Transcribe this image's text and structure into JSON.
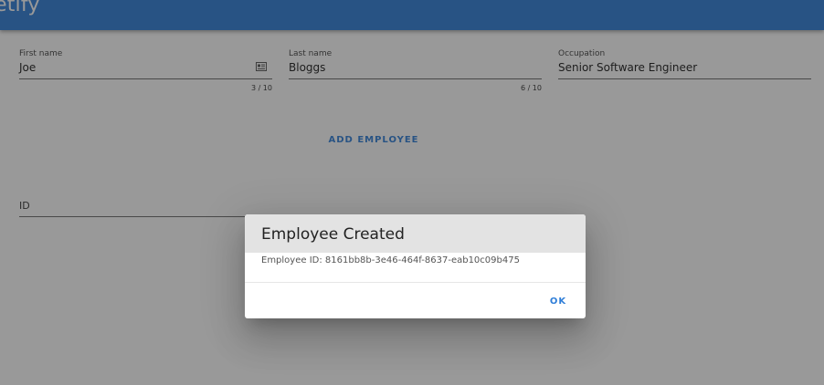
{
  "app": {
    "title_fragment": "etify",
    "bar_color": "#2f7ed8"
  },
  "form": {
    "first_name": {
      "label": "First name",
      "value": "Joe",
      "counter": "3 / 10",
      "icon": "card-icon"
    },
    "last_name": {
      "label": "Last name",
      "value": "Bloggs",
      "counter": "6 / 10"
    },
    "occupation": {
      "label": "Occupation",
      "value": "Senior Software Engineer"
    },
    "add_button_label": "ADD EMPLOYEE",
    "id_field": {
      "label": "ID"
    }
  },
  "dialog": {
    "title": "Employee Created",
    "message": "Employee ID: 8161bb8b-3e46-464f-8637-eab10c09b475",
    "ok_label": "OK"
  },
  "colors": {
    "primary": "#2f7ed8",
    "overlay": "rgba(33,33,33,0.46)",
    "dialog_header": "#e3e3e3"
  }
}
